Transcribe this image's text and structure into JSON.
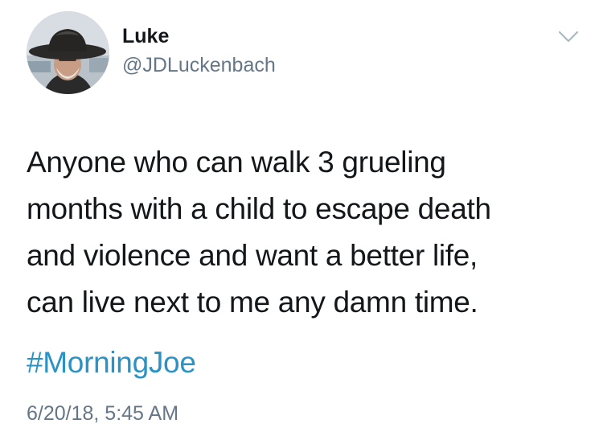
{
  "user": {
    "display_name": "Luke",
    "handle": "@JDLuckenbach"
  },
  "icons": {
    "menu": "chevron-down-icon",
    "avatar": "avatar-cowboy-hat"
  },
  "tweet": {
    "lines": [
      "Anyone who can walk 3 grueling",
      "months with a child to escape death",
      "and violence and want a better life,",
      "can live next to me any damn time."
    ],
    "hashtag": "#MorningJoe",
    "timestamp": "6/20/18, 5:45 AM"
  },
  "colors": {
    "text": "#14171a",
    "secondary": "#657786",
    "link": "#2b92c6"
  }
}
